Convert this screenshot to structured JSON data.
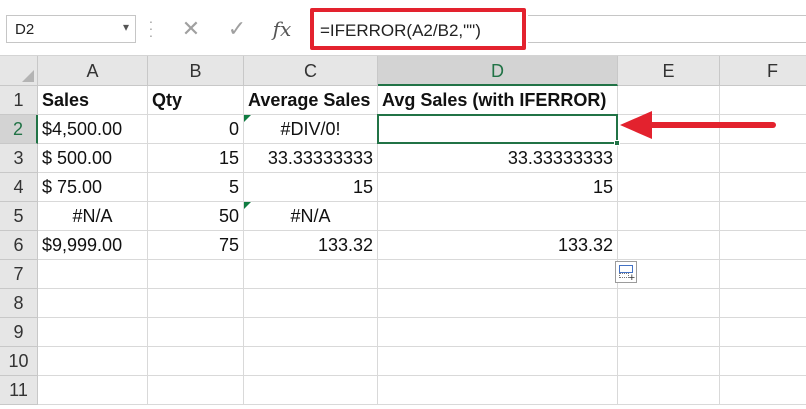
{
  "name_box": {
    "value": "D2"
  },
  "formula_bar": {
    "value": "=IFERROR(A2/B2,\"\")",
    "fx_label": "fx",
    "cancel_icon": "✕",
    "enter_icon": "✓"
  },
  "columns": [
    "A",
    "B",
    "C",
    "D",
    "E",
    "F"
  ],
  "rows": [
    "1",
    "2",
    "3",
    "4",
    "5",
    "6",
    "7",
    "8",
    "9",
    "10",
    "11"
  ],
  "cells": {
    "A1": "Sales",
    "B1": "Qty",
    "C1": "Average Sales",
    "D1": "Avg Sales (with IFERROR)",
    "A2": "$4,500.00",
    "B2": "0",
    "C2": "#DIV/0!",
    "D2": "",
    "A3": "$   500.00",
    "B3": "15",
    "C3": "33.33333333",
    "D3": "33.33333333",
    "A4": "$     75.00",
    "B4": "5",
    "C4": "15",
    "D4": "15",
    "A5": "#N/A",
    "B5": "50",
    "C5": "#N/A",
    "D5": "",
    "A6": "$9,999.00",
    "B6": "75",
    "C6": "133.32",
    "D6": "133.32"
  },
  "active_cell": "D2",
  "colors": {
    "accent": "#217346",
    "highlight_box": "#e3222e",
    "arrow": "#e3222e",
    "error_indicator": "#107c41"
  },
  "icons": {
    "quick_analysis": "quick-analysis-icon",
    "arrow": "arrow-left-icon"
  }
}
